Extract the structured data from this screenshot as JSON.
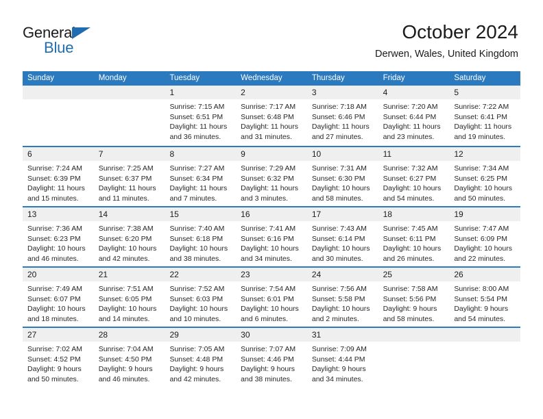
{
  "brand": {
    "word1": "General",
    "word2": "Blue",
    "triangle_color": "#1f6cb0"
  },
  "header": {
    "title": "October 2024",
    "location": "Derwen, Wales, United Kingdom"
  },
  "theme": {
    "header_blue": "#2b79bf",
    "band_gray": "#efefef",
    "text": "#1b1b1b"
  },
  "calendar": {
    "weekdays": [
      "Sunday",
      "Monday",
      "Tuesday",
      "Wednesday",
      "Thursday",
      "Friday",
      "Saturday"
    ],
    "labels": {
      "sunrise": "Sunrise:",
      "sunset": "Sunset:",
      "daylight": "Daylight:"
    },
    "weeks": [
      [
        {
          "day": "",
          "empty": true
        },
        {
          "day": "",
          "empty": true
        },
        {
          "day": "1",
          "sunrise": "Sunrise: 7:15 AM",
          "sunset": "Sunset: 6:51 PM",
          "daylight": "Daylight: 11 hours and 36 minutes."
        },
        {
          "day": "2",
          "sunrise": "Sunrise: 7:17 AM",
          "sunset": "Sunset: 6:48 PM",
          "daylight": "Daylight: 11 hours and 31 minutes."
        },
        {
          "day": "3",
          "sunrise": "Sunrise: 7:18 AM",
          "sunset": "Sunset: 6:46 PM",
          "daylight": "Daylight: 11 hours and 27 minutes."
        },
        {
          "day": "4",
          "sunrise": "Sunrise: 7:20 AM",
          "sunset": "Sunset: 6:44 PM",
          "daylight": "Daylight: 11 hours and 23 minutes."
        },
        {
          "day": "5",
          "sunrise": "Sunrise: 7:22 AM",
          "sunset": "Sunset: 6:41 PM",
          "daylight": "Daylight: 11 hours and 19 minutes."
        }
      ],
      [
        {
          "day": "6",
          "sunrise": "Sunrise: 7:24 AM",
          "sunset": "Sunset: 6:39 PM",
          "daylight": "Daylight: 11 hours and 15 minutes."
        },
        {
          "day": "7",
          "sunrise": "Sunrise: 7:25 AM",
          "sunset": "Sunset: 6:37 PM",
          "daylight": "Daylight: 11 hours and 11 minutes."
        },
        {
          "day": "8",
          "sunrise": "Sunrise: 7:27 AM",
          "sunset": "Sunset: 6:34 PM",
          "daylight": "Daylight: 11 hours and 7 minutes."
        },
        {
          "day": "9",
          "sunrise": "Sunrise: 7:29 AM",
          "sunset": "Sunset: 6:32 PM",
          "daylight": "Daylight: 11 hours and 3 minutes."
        },
        {
          "day": "10",
          "sunrise": "Sunrise: 7:31 AM",
          "sunset": "Sunset: 6:30 PM",
          "daylight": "Daylight: 10 hours and 58 minutes."
        },
        {
          "day": "11",
          "sunrise": "Sunrise: 7:32 AM",
          "sunset": "Sunset: 6:27 PM",
          "daylight": "Daylight: 10 hours and 54 minutes."
        },
        {
          "day": "12",
          "sunrise": "Sunrise: 7:34 AM",
          "sunset": "Sunset: 6:25 PM",
          "daylight": "Daylight: 10 hours and 50 minutes."
        }
      ],
      [
        {
          "day": "13",
          "sunrise": "Sunrise: 7:36 AM",
          "sunset": "Sunset: 6:23 PM",
          "daylight": "Daylight: 10 hours and 46 minutes."
        },
        {
          "day": "14",
          "sunrise": "Sunrise: 7:38 AM",
          "sunset": "Sunset: 6:20 PM",
          "daylight": "Daylight: 10 hours and 42 minutes."
        },
        {
          "day": "15",
          "sunrise": "Sunrise: 7:40 AM",
          "sunset": "Sunset: 6:18 PM",
          "daylight": "Daylight: 10 hours and 38 minutes."
        },
        {
          "day": "16",
          "sunrise": "Sunrise: 7:41 AM",
          "sunset": "Sunset: 6:16 PM",
          "daylight": "Daylight: 10 hours and 34 minutes."
        },
        {
          "day": "17",
          "sunrise": "Sunrise: 7:43 AM",
          "sunset": "Sunset: 6:14 PM",
          "daylight": "Daylight: 10 hours and 30 minutes."
        },
        {
          "day": "18",
          "sunrise": "Sunrise: 7:45 AM",
          "sunset": "Sunset: 6:11 PM",
          "daylight": "Daylight: 10 hours and 26 minutes."
        },
        {
          "day": "19",
          "sunrise": "Sunrise: 7:47 AM",
          "sunset": "Sunset: 6:09 PM",
          "daylight": "Daylight: 10 hours and 22 minutes."
        }
      ],
      [
        {
          "day": "20",
          "sunrise": "Sunrise: 7:49 AM",
          "sunset": "Sunset: 6:07 PM",
          "daylight": "Daylight: 10 hours and 18 minutes."
        },
        {
          "day": "21",
          "sunrise": "Sunrise: 7:51 AM",
          "sunset": "Sunset: 6:05 PM",
          "daylight": "Daylight: 10 hours and 14 minutes."
        },
        {
          "day": "22",
          "sunrise": "Sunrise: 7:52 AM",
          "sunset": "Sunset: 6:03 PM",
          "daylight": "Daylight: 10 hours and 10 minutes."
        },
        {
          "day": "23",
          "sunrise": "Sunrise: 7:54 AM",
          "sunset": "Sunset: 6:01 PM",
          "daylight": "Daylight: 10 hours and 6 minutes."
        },
        {
          "day": "24",
          "sunrise": "Sunrise: 7:56 AM",
          "sunset": "Sunset: 5:58 PM",
          "daylight": "Daylight: 10 hours and 2 minutes."
        },
        {
          "day": "25",
          "sunrise": "Sunrise: 7:58 AM",
          "sunset": "Sunset: 5:56 PM",
          "daylight": "Daylight: 9 hours and 58 minutes."
        },
        {
          "day": "26",
          "sunrise": "Sunrise: 8:00 AM",
          "sunset": "Sunset: 5:54 PM",
          "daylight": "Daylight: 9 hours and 54 minutes."
        }
      ],
      [
        {
          "day": "27",
          "sunrise": "Sunrise: 7:02 AM",
          "sunset": "Sunset: 4:52 PM",
          "daylight": "Daylight: 9 hours and 50 minutes."
        },
        {
          "day": "28",
          "sunrise": "Sunrise: 7:04 AM",
          "sunset": "Sunset: 4:50 PM",
          "daylight": "Daylight: 9 hours and 46 minutes."
        },
        {
          "day": "29",
          "sunrise": "Sunrise: 7:05 AM",
          "sunset": "Sunset: 4:48 PM",
          "daylight": "Daylight: 9 hours and 42 minutes."
        },
        {
          "day": "30",
          "sunrise": "Sunrise: 7:07 AM",
          "sunset": "Sunset: 4:46 PM",
          "daylight": "Daylight: 9 hours and 38 minutes."
        },
        {
          "day": "31",
          "sunrise": "Sunrise: 7:09 AM",
          "sunset": "Sunset: 4:44 PM",
          "daylight": "Daylight: 9 hours and 34 minutes."
        },
        {
          "day": "",
          "empty": true
        },
        {
          "day": "",
          "empty": true
        }
      ]
    ]
  }
}
